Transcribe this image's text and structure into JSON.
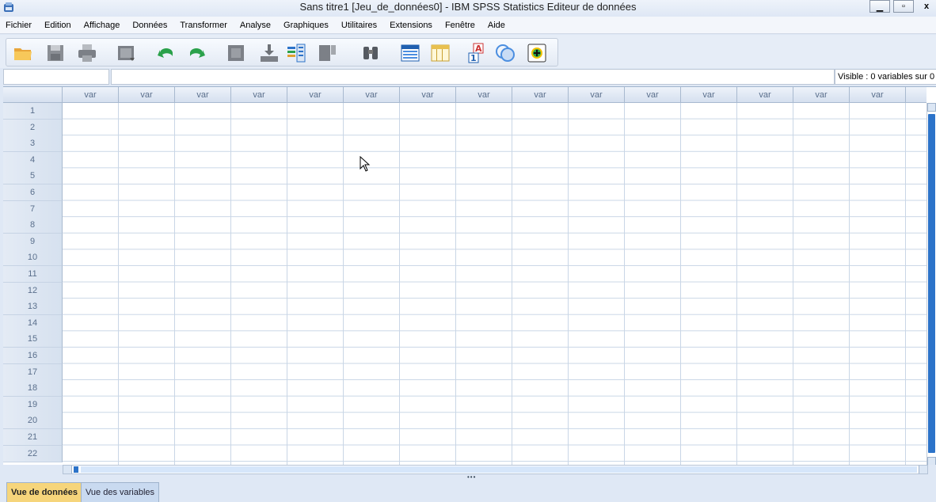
{
  "window": {
    "title": "Sans titre1 [Jeu_de_données0] - IBM SPSS Statistics Editeur de données",
    "minimize_label": "▁",
    "restore_label": "▫",
    "close_label": "x"
  },
  "menu": [
    {
      "label": "Fichier"
    },
    {
      "label": "Edition"
    },
    {
      "label": "Affichage"
    },
    {
      "label": "Données"
    },
    {
      "label": "Transformer"
    },
    {
      "label": "Analyse"
    },
    {
      "label": "Graphiques"
    },
    {
      "label": "Utilitaires"
    },
    {
      "label": "Extensions"
    },
    {
      "label": "Fenêtre"
    },
    {
      "label": "Aide"
    }
  ],
  "toolbar": [
    {
      "icon": "open-folder-icon"
    },
    {
      "icon": "save-icon"
    },
    {
      "icon": "print-icon"
    },
    {
      "icon": "dialog-recall-icon"
    },
    {
      "icon": "undo-icon"
    },
    {
      "icon": "redo-icon"
    },
    {
      "icon": "goto-case-icon"
    },
    {
      "icon": "goto-variable-icon"
    },
    {
      "icon": "variables-icon"
    },
    {
      "icon": "run-descriptive-icon"
    },
    {
      "icon": "find-icon"
    },
    {
      "icon": "insert-cases-icon"
    },
    {
      "icon": "insert-variable-icon"
    },
    {
      "icon": "value-labels-icon"
    },
    {
      "icon": "use-sets-icon"
    },
    {
      "icon": "spelling-icon"
    }
  ],
  "editor": {
    "visible_text": "Visible : 0 variables sur 0"
  },
  "grid": {
    "column_header": "var",
    "column_headers": [
      "var",
      "var",
      "var",
      "var",
      "var",
      "var",
      "var",
      "var",
      "var",
      "var",
      "var",
      "var",
      "var",
      "var",
      "var",
      "v"
    ],
    "rows": [
      "1",
      "2",
      "3",
      "4",
      "5",
      "6",
      "7",
      "8",
      "9",
      "10",
      "11",
      "12",
      "13",
      "14",
      "15",
      "16",
      "17",
      "18",
      "19",
      "20",
      "21",
      "22"
    ]
  },
  "tabs": {
    "data_view": "Vue de données",
    "variable_view": "Vue des variables"
  },
  "colors": {
    "active_tab": "#f6d57b",
    "inactive_tab": "#c9daf0",
    "scroll_thumb": "#2c73c9",
    "grid_line": "#c9d6e6"
  }
}
